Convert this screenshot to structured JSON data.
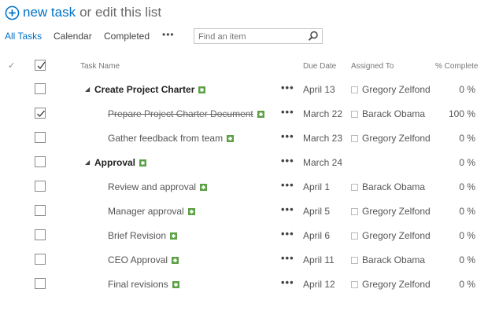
{
  "header": {
    "new_task_label": "new task",
    "or_label": "or",
    "edit_label": "edit",
    "this_list_label": "this list"
  },
  "views": {
    "items": [
      "All Tasks",
      "Calendar",
      "Completed"
    ],
    "active": "All Tasks",
    "more_label": "•••"
  },
  "search": {
    "placeholder": "Find an item"
  },
  "columns": {
    "check": "✓",
    "task_name": "Task Name",
    "due_date": "Due Date",
    "assigned_to": "Assigned To",
    "percent_complete": "% Complete"
  },
  "tasks": [
    {
      "name": "Create Project Charter",
      "summary": true,
      "checked": false,
      "due": "April 13",
      "assigned": "Gregory Zelfond",
      "percent": "0 %"
    },
    {
      "name": "Prepare Project Charter Document",
      "summary": false,
      "checked": true,
      "strikethrough": true,
      "due": "March 22",
      "assigned": "Barack Obama",
      "percent": "100 %"
    },
    {
      "name": "Gather feedback from team",
      "summary": false,
      "checked": false,
      "due": "March 23",
      "assigned": "Gregory Zelfond",
      "percent": "0 %"
    },
    {
      "name": "Approval",
      "summary": true,
      "checked": false,
      "due": "March 24",
      "assigned": "",
      "percent": "0 %"
    },
    {
      "name": "Review and approval",
      "summary": false,
      "checked": false,
      "due": "April 1",
      "assigned": "Barack Obama",
      "percent": "0 %"
    },
    {
      "name": "Manager approval",
      "summary": false,
      "checked": false,
      "due": "April 5",
      "assigned": "Gregory Zelfond",
      "percent": "0 %"
    },
    {
      "name": "Brief Revision",
      "summary": false,
      "checked": false,
      "due": "April 6",
      "assigned": "Gregory Zelfond",
      "percent": "0 %"
    },
    {
      "name": "CEO Approval",
      "summary": false,
      "checked": false,
      "due": "April 11",
      "assigned": "Barack Obama",
      "percent": "0 %"
    },
    {
      "name": "Final revisions",
      "summary": false,
      "checked": false,
      "due": "April 12",
      "assigned": "Gregory Zelfond",
      "percent": "0 %"
    }
  ],
  "row_menu_label": "•••",
  "colors": {
    "accent": "#0072c6",
    "new_badge": "#5ca045",
    "checkbox_border": "#8a8a8a"
  }
}
